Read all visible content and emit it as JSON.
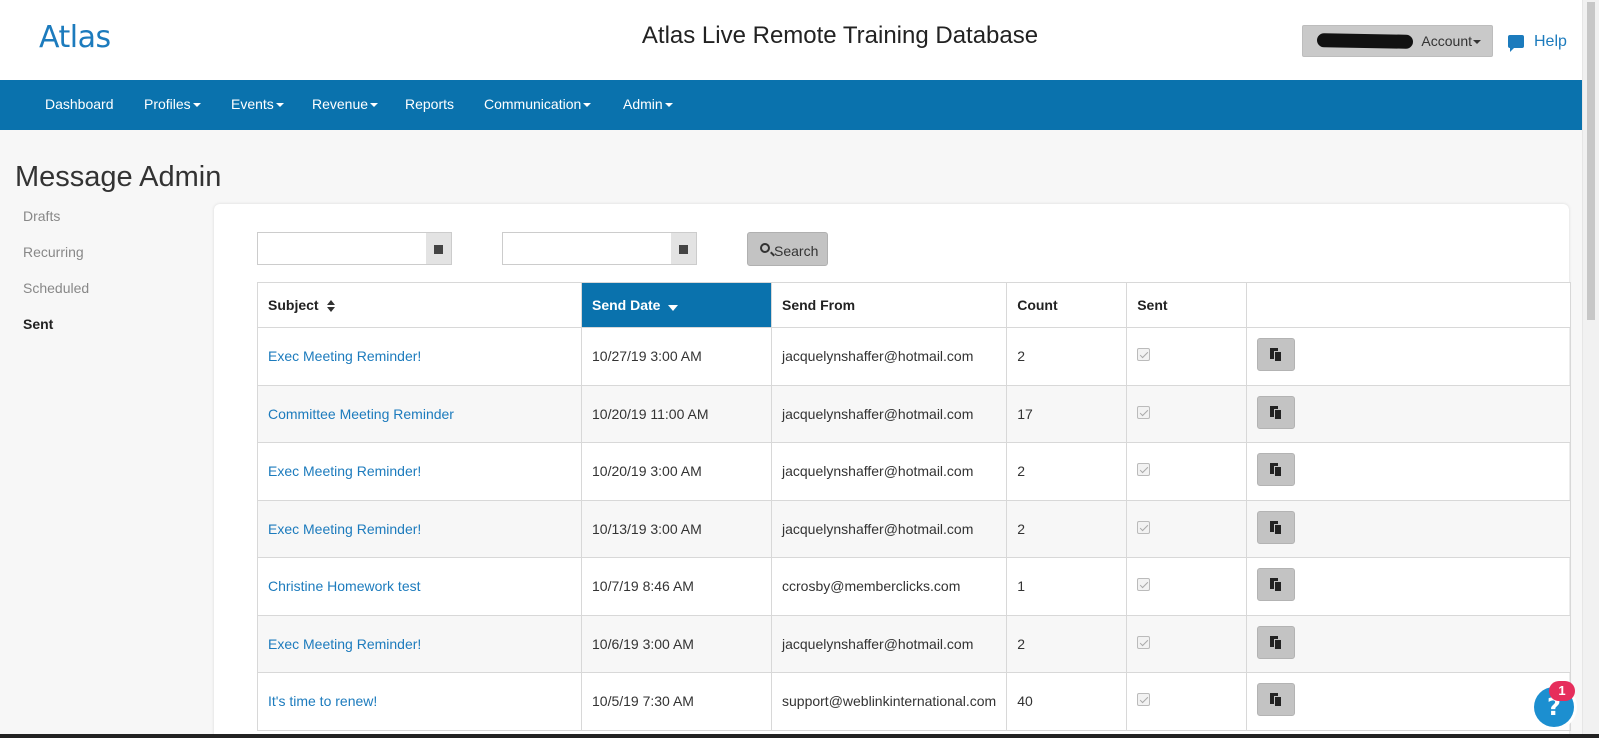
{
  "header": {
    "logo": "Atlas",
    "app_title": "Atlas Live Remote Training Database",
    "account_label": "Account",
    "help_label": "Help"
  },
  "nav": {
    "items": [
      {
        "label": "Dashboard",
        "dropdown": false
      },
      {
        "label": "Profiles",
        "dropdown": true
      },
      {
        "label": "Events",
        "dropdown": true
      },
      {
        "label": "Revenue",
        "dropdown": true
      },
      {
        "label": "Reports",
        "dropdown": false
      },
      {
        "label": "Communication",
        "dropdown": true
      },
      {
        "label": "Admin",
        "dropdown": true
      }
    ]
  },
  "page": {
    "title": "Message Admin"
  },
  "sidebar": {
    "items": [
      {
        "label": "Drafts",
        "active": false
      },
      {
        "label": "Recurring",
        "active": false
      },
      {
        "label": "Scheduled",
        "active": false
      },
      {
        "label": "Sent",
        "active": true
      }
    ]
  },
  "filters": {
    "start_date": "",
    "end_date": "",
    "search_label": "Search"
  },
  "table": {
    "columns": [
      "Subject",
      "Send Date",
      "Send From",
      "Count",
      "Sent",
      ""
    ],
    "sorted_column": "Send Date",
    "rows": [
      {
        "subject": "Exec Meeting Reminder!",
        "send_date": "10/27/19 3:00 AM",
        "send_from": "jacquelynshaffer@hotmail.com",
        "count": "2",
        "sent": true
      },
      {
        "subject": "Committee Meeting Reminder",
        "send_date": "10/20/19 11:00 AM",
        "send_from": "jacquelynshaffer@hotmail.com",
        "count": "17",
        "sent": true
      },
      {
        "subject": "Exec Meeting Reminder!",
        "send_date": "10/20/19 3:00 AM",
        "send_from": "jacquelynshaffer@hotmail.com",
        "count": "2",
        "sent": true
      },
      {
        "subject": "Exec Meeting Reminder!",
        "send_date": "10/13/19 3:00 AM",
        "send_from": "jacquelynshaffer@hotmail.com",
        "count": "2",
        "sent": true
      },
      {
        "subject": "Christine Homework test",
        "send_date": "10/7/19 8:46 AM",
        "send_from": "ccrosby@memberclicks.com",
        "count": "1",
        "sent": true
      },
      {
        "subject": "Exec Meeting Reminder!",
        "send_date": "10/6/19 3:00 AM",
        "send_from": "jacquelynshaffer@hotmail.com",
        "count": "2",
        "sent": true
      },
      {
        "subject": "It's time to renew!",
        "send_date": "10/5/19 7:30 AM",
        "send_from": "support@weblinkinternational.com",
        "count": "40",
        "sent": true
      }
    ]
  },
  "widget": {
    "help_symbol": "?",
    "badge_count": "1"
  },
  "colors": {
    "brand_blue": "#0a72ad",
    "link_blue": "#1c7bbd",
    "badge_red": "#e62e5c"
  }
}
